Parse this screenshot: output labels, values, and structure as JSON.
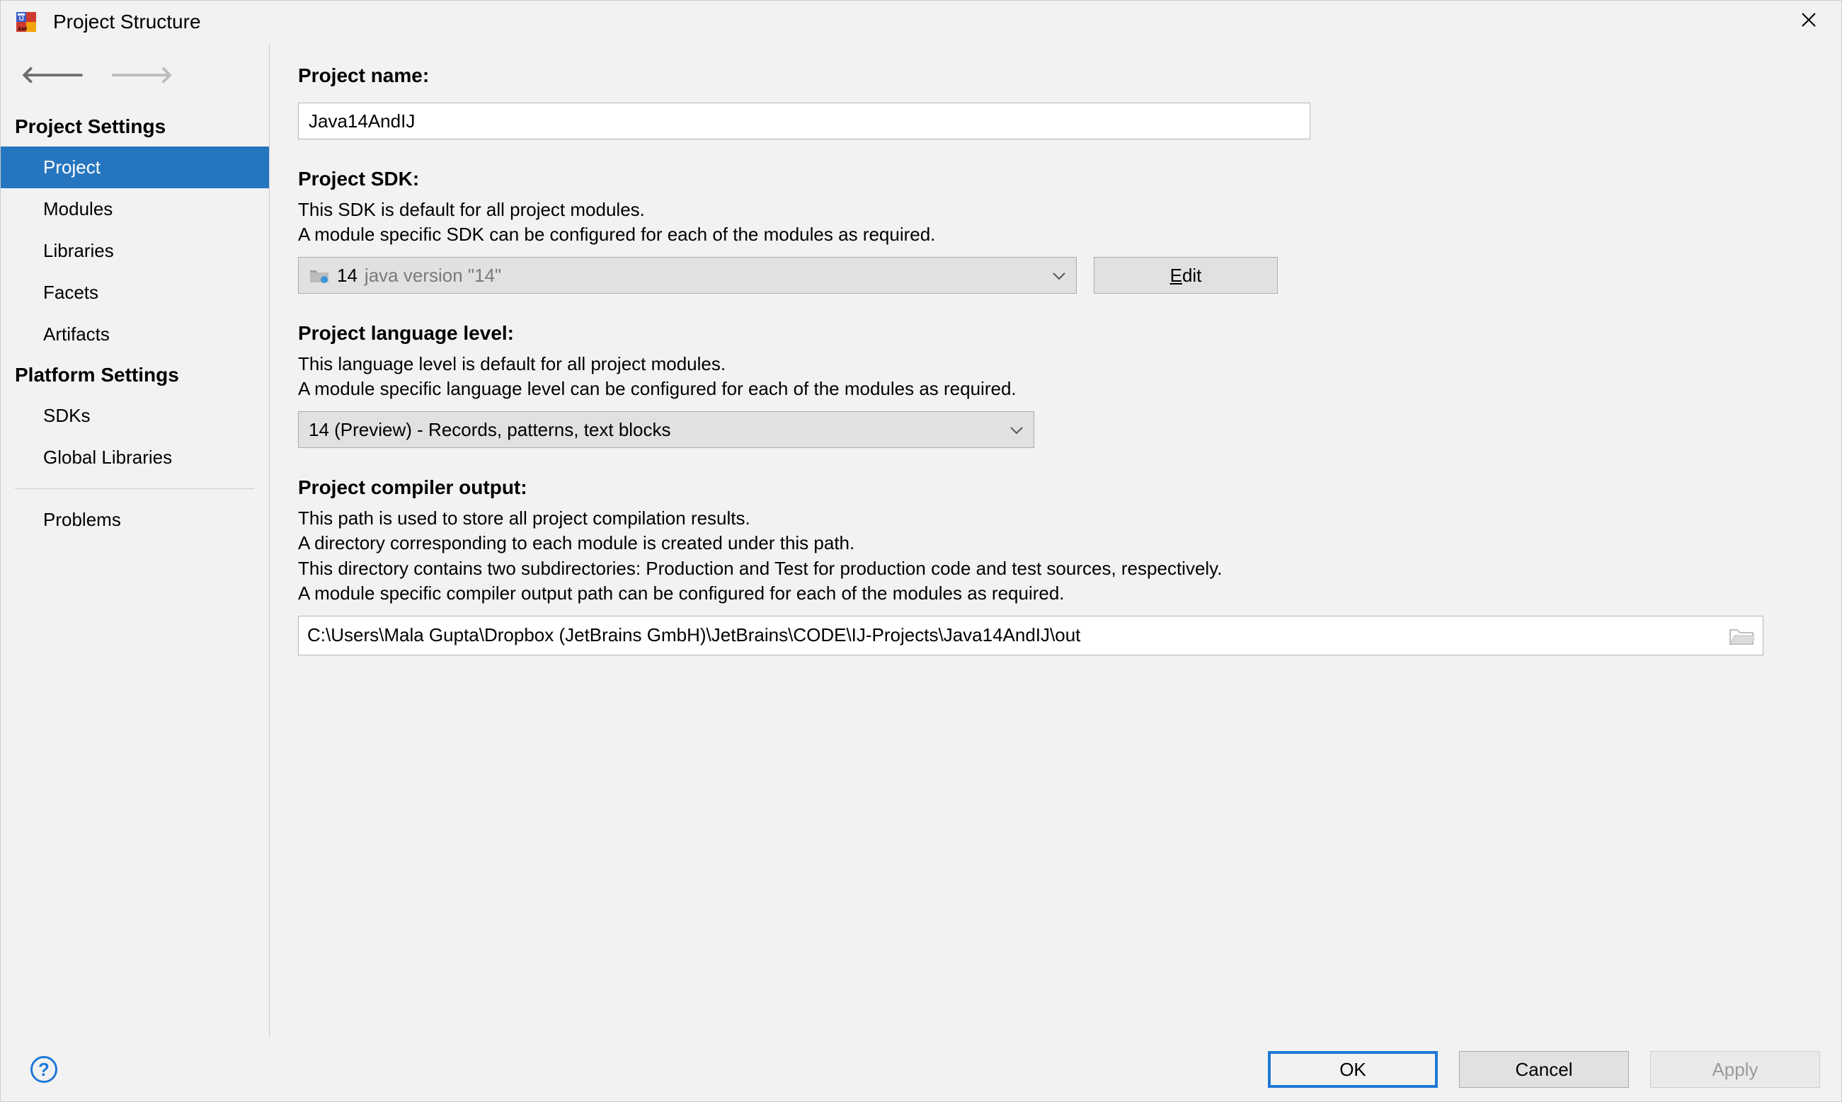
{
  "window": {
    "title": "Project Structure"
  },
  "sidebar": {
    "section1_label": "Project Settings",
    "items1": [
      "Project",
      "Modules",
      "Libraries",
      "Facets",
      "Artifacts"
    ],
    "section2_label": "Platform Settings",
    "items2": [
      "SDKs",
      "Global Libraries"
    ],
    "section3_items": [
      "Problems"
    ]
  },
  "content": {
    "project_name_label": "Project name:",
    "project_name_value": "Java14AndIJ",
    "sdk_label": "Project SDK:",
    "sdk_desc_line1": "This SDK is default for all project modules.",
    "sdk_desc_line2": "A module specific SDK can be configured for each of the modules as required.",
    "sdk_selected_main": "14",
    "sdk_selected_sub": "java version \"14\"",
    "edit_button": "Edit",
    "lang_label": "Project language level:",
    "lang_desc_line1": "This language level is default for all project modules.",
    "lang_desc_line2": "A module specific language level can be configured for each of the modules as required.",
    "lang_selected": "14 (Preview) - Records, patterns, text blocks",
    "output_label": "Project compiler output:",
    "output_desc_line1": "This path is used to store all project compilation results.",
    "output_desc_line2": "A directory corresponding to each module is created under this path.",
    "output_desc_line3": "This directory contains two subdirectories: Production and Test for production code and test sources, respectively.",
    "output_desc_line4": "A module specific compiler output path can be configured for each of the modules as required.",
    "output_path": "C:\\Users\\Mala Gupta\\Dropbox (JetBrains GmbH)\\JetBrains\\CODE\\IJ-Projects\\Java14AndIJ\\out"
  },
  "footer": {
    "ok": "OK",
    "cancel": "Cancel",
    "apply": "Apply"
  }
}
